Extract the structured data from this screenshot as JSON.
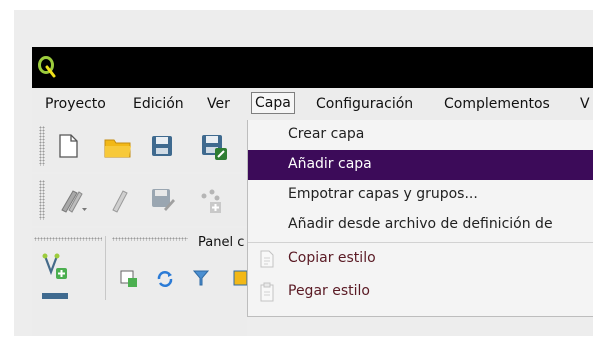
{
  "menubar": {
    "items": [
      {
        "label": "Proyecto"
      },
      {
        "label": "Edición"
      },
      {
        "label": "Ver"
      },
      {
        "label": "Capa"
      },
      {
        "label": "Configuración"
      },
      {
        "label": "Complementos"
      },
      {
        "label": "V"
      }
    ],
    "active": "Capa"
  },
  "panel": {
    "label": "Panel c"
  },
  "dropdown": {
    "items": [
      {
        "label": "Crear capa",
        "highlighted": false,
        "enabled": true,
        "icon": ""
      },
      {
        "label": "Añadir capa",
        "highlighted": true,
        "enabled": true,
        "icon": ""
      },
      {
        "label": "Empotrar capas y grupos...",
        "highlighted": false,
        "enabled": true,
        "icon": ""
      },
      {
        "label": "Añadir desde archivo de definición de",
        "highlighted": false,
        "enabled": true,
        "icon": ""
      },
      {
        "label": "Copiar estilo",
        "highlighted": false,
        "enabled": false,
        "icon": "copy-style-icon"
      },
      {
        "label": "Pegar estilo",
        "highlighted": false,
        "enabled": false,
        "icon": "paste-style-icon"
      }
    ]
  },
  "colors": {
    "titlebar": "#000000",
    "highlight": "#3c0b59",
    "qgis_logo": "#9ccc3d",
    "folder": "#f2b817",
    "save_blue": "#3f6a8f"
  }
}
